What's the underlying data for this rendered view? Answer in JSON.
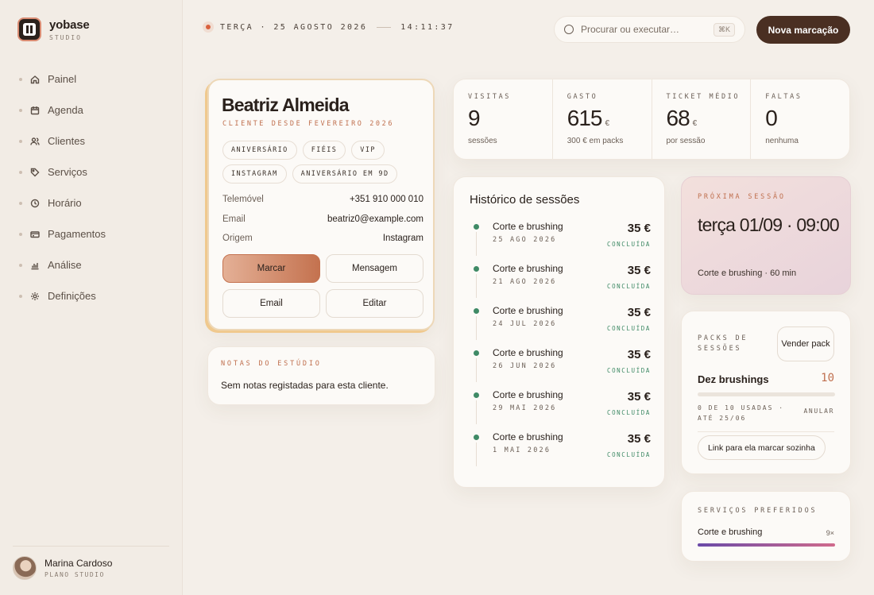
{
  "brand": {
    "name": "yobase",
    "sub": "STUDIO"
  },
  "nav": [
    {
      "label": "Painel",
      "icon": "home-icon"
    },
    {
      "label": "Agenda",
      "icon": "calendar-icon"
    },
    {
      "label": "Clientes",
      "icon": "users-icon"
    },
    {
      "label": "Serviços",
      "icon": "tag-icon"
    },
    {
      "label": "Horário",
      "icon": "clock-icon"
    },
    {
      "label": "Pagamentos",
      "icon": "card-icon"
    },
    {
      "label": "Análise",
      "icon": "bar-chart-icon"
    },
    {
      "label": "Definições",
      "icon": "gear-icon"
    }
  ],
  "user": {
    "name": "Marina Cardoso",
    "plan": "PLANO STUDIO"
  },
  "topbar": {
    "date": "TERÇA · 25 AGOSTO 2026",
    "time": "14:11:37",
    "search_placeholder": "Procurar ou executar…",
    "search_shortcut": "⌘K",
    "new_button": "Nova marcação"
  },
  "profile": {
    "name": "Beatriz Almeida",
    "since": "CLIENTE DESDE FEVEREIRO 2026",
    "tags": [
      "ANIVERSÁRIO",
      "FIÉIS",
      "VIP",
      "INSTAGRAM",
      "ANIVERSÁRIO EM 9D"
    ],
    "fields": [
      {
        "key": "Telemóvel",
        "value": "+351 910 000 010"
      },
      {
        "key": "Email",
        "value": "beatriz0@example.com"
      },
      {
        "key": "Origem",
        "value": "Instagram"
      }
    ],
    "actions": {
      "book": "Marcar",
      "message": "Mensagem",
      "email": "Email",
      "edit": "Editar"
    }
  },
  "notes": {
    "title": "NOTAS DO ESTÚDIO",
    "text": "Sem notas registadas para esta cliente."
  },
  "stats": [
    {
      "label": "VISITAS",
      "value": "9",
      "unit": "",
      "sub": "sessões"
    },
    {
      "label": "GASTO",
      "value": "615",
      "unit": "€",
      "sub": "300 € em packs"
    },
    {
      "label": "TICKET MÉDIO",
      "value": "68",
      "unit": "€",
      "sub": "por sessão"
    },
    {
      "label": "FALTAS",
      "value": "0",
      "unit": "",
      "sub": "nenhuma"
    }
  ],
  "history": {
    "title": "Histórico de sessões",
    "items": [
      {
        "service": "Corte e brushing",
        "date": "25 AGO 2026",
        "price": "35 €",
        "status": "CONCLUÍDA"
      },
      {
        "service": "Corte e brushing",
        "date": "21 AGO 2026",
        "price": "35 €",
        "status": "CONCLUÍDA"
      },
      {
        "service": "Corte e brushing",
        "date": "24 JUL 2026",
        "price": "35 €",
        "status": "CONCLUÍDA"
      },
      {
        "service": "Corte e brushing",
        "date": "26 JUN 2026",
        "price": "35 €",
        "status": "CONCLUÍDA"
      },
      {
        "service": "Corte e brushing",
        "date": "29 MAI 2026",
        "price": "35 €",
        "status": "CONCLUÍDA"
      },
      {
        "service": "Corte e brushing",
        "date": "1 MAI 2026",
        "price": "35 €",
        "status": "CONCLUÍDA"
      }
    ]
  },
  "next_session": {
    "label": "PRÓXIMA SESSÃO",
    "when": "terça 01/09 · 09:00",
    "service": "Corte e brushing · 60 min"
  },
  "packs": {
    "label": "PACKS DE SESSÕES",
    "sell_button": "Vender pack",
    "name": "Dez brushings",
    "count": "10",
    "usage": "0 DE 10 USADAS · ATÉ 25/06",
    "used_fraction": 0,
    "cancel": "ANULAR",
    "link_button": "Link para ela marcar sozinha"
  },
  "favorites": {
    "label": "SERVIÇOS PREFERIDOS",
    "service": "Corte e brushing",
    "count": "9×",
    "fill_fraction": 1.0
  },
  "colors": {
    "accent": "#c0704f",
    "success": "#3f8a66",
    "primary_button": "#4a2f22",
    "background": "#f4efe9"
  }
}
